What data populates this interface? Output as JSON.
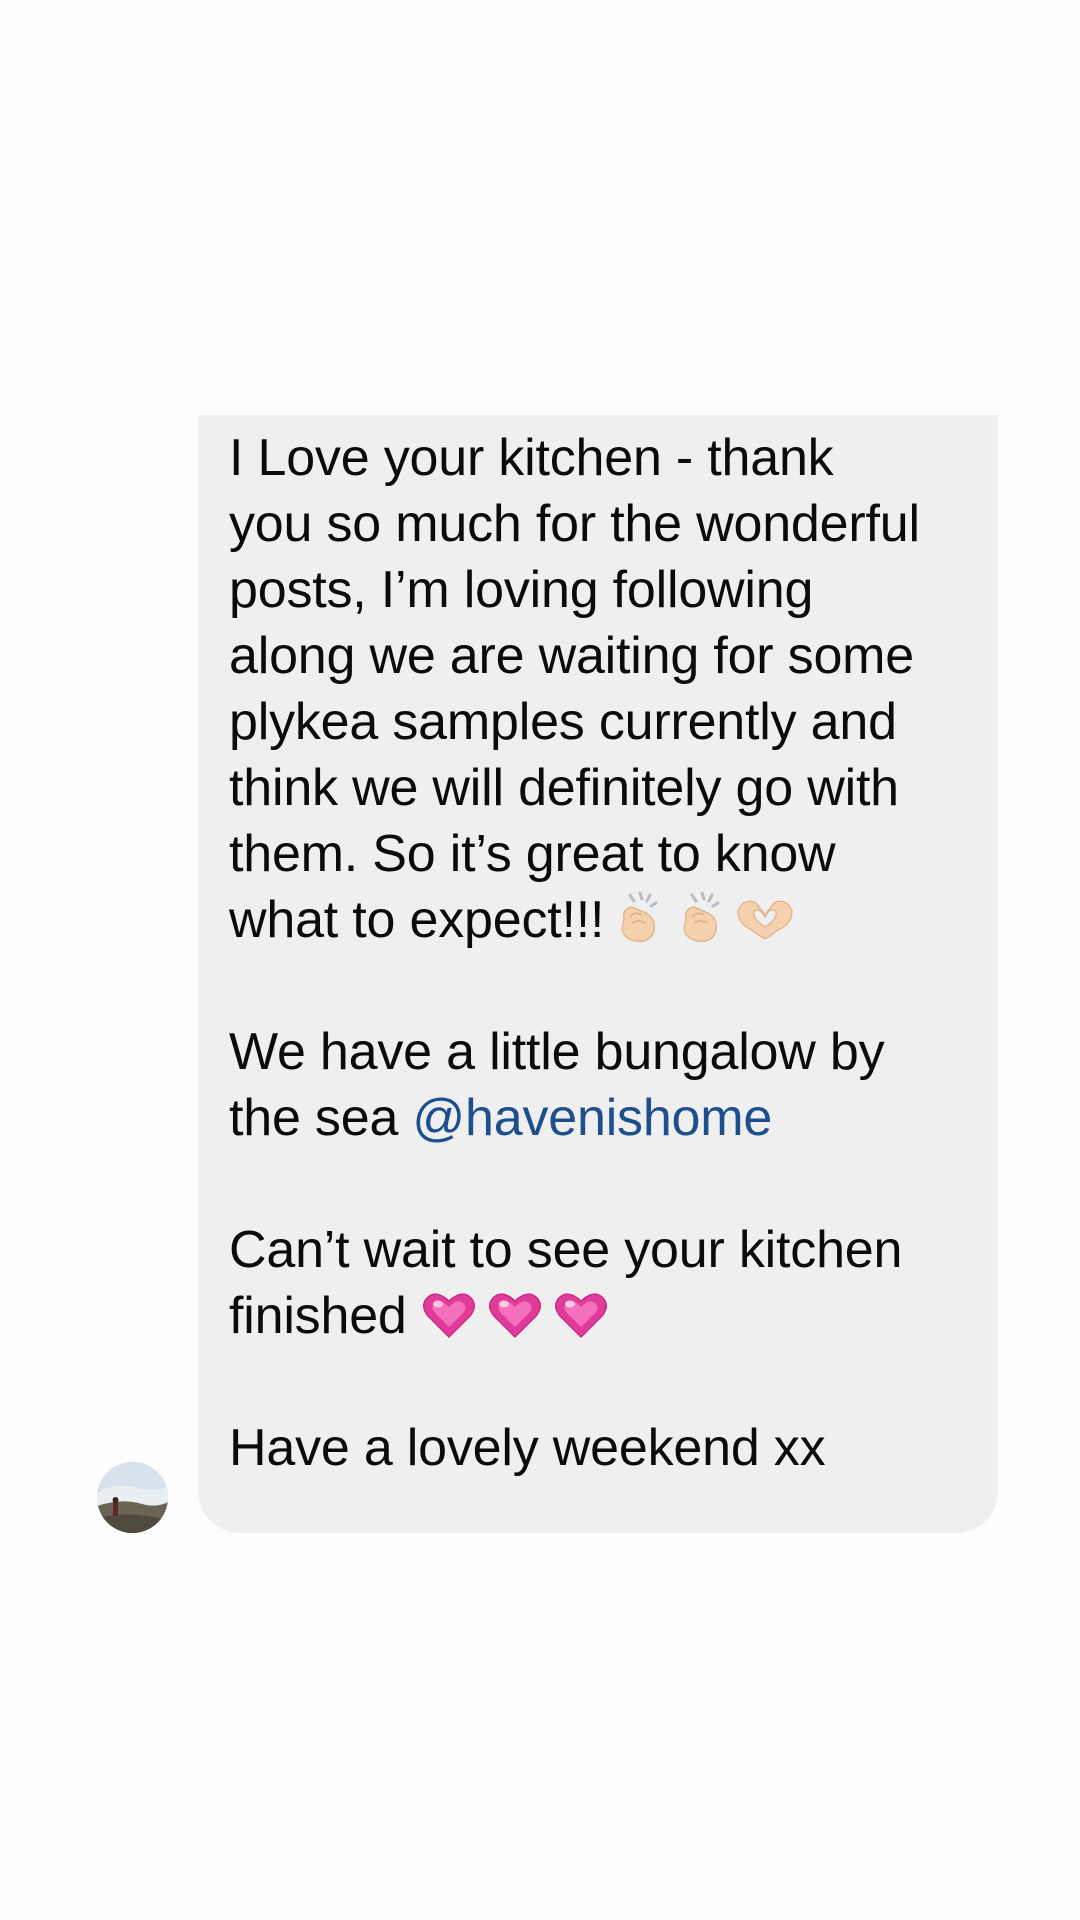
{
  "message": {
    "paragraph_1": {
      "lines": [
        "I Love your kitchen - thank",
        "you so much for the wonderful",
        "posts, I’m loving following",
        "along we are waiting for some",
        "plykea samples currently and",
        "think we will definitely go with",
        "them. So it’s great to know",
        "what to expect!!!"
      ],
      "emojis": [
        "clapping-hands",
        "clapping-hands",
        "heart-hands"
      ]
    },
    "paragraph_2": {
      "line_1": "We have a little bungalow by",
      "line_2_prefix": "the sea ",
      "mention": "@havenishome"
    },
    "paragraph_3": {
      "line_1": "Can’t wait to see your kitchen",
      "line_2": "finished",
      "emojis": [
        "pink-heart",
        "pink-heart",
        "pink-heart"
      ]
    },
    "paragraph_4": {
      "line_1": "Have a lovely weekend xx"
    }
  },
  "colors": {
    "bubble_background": "#efefef",
    "text": "#0b0b0b",
    "mention": "#1d4f8c",
    "page_background": "#fdfdfd"
  },
  "sender": {
    "avatar_icon": "avatar-photo"
  }
}
